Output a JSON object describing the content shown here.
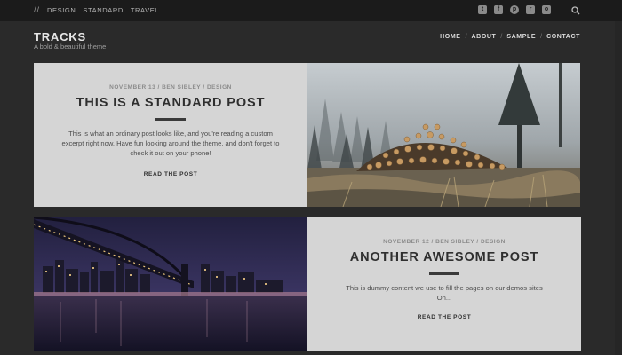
{
  "topbar": {
    "slashes": "//",
    "nav": [
      "DESIGN",
      "STANDARD",
      "TRAVEL"
    ],
    "socials": [
      {
        "icon": "twitter-icon",
        "glyph": "t"
      },
      {
        "icon": "facebook-icon",
        "glyph": "f"
      },
      {
        "icon": "pinterest-icon",
        "glyph": "p"
      },
      {
        "icon": "rss-icon",
        "glyph": "r"
      },
      {
        "icon": "instagram-icon",
        "glyph": "o"
      }
    ],
    "search_icon": "search-icon"
  },
  "header": {
    "brand": "TRACKS",
    "tagline": "A bold & beautiful theme",
    "nav": [
      "HOME",
      "ABOUT",
      "SAMPLE",
      "CONTACT"
    ],
    "separator": "/"
  },
  "posts": [
    {
      "meta": "NOVEMBER 13 / BEN SIBLEY / DESIGN",
      "title": "THIS IS A STANDARD POST",
      "excerpt": "This is what an ordinary post looks like, and you're reading a custom excerpt right now. Have fun looking around the theme, and don't forget to check it out on your phone!",
      "read_more": "READ THE POST",
      "image": "foggy-forest-log-pile"
    },
    {
      "meta": "NOVEMBER 12 / BEN SIBLEY / DESIGN",
      "title": "ANOTHER AWESOME POST",
      "excerpt": "This is dummy content we use to fill the pages on our demos sites On...",
      "read_more": "READ THE POST",
      "image": "city-bridge-at-night"
    }
  ],
  "colors": {
    "background": "#2a2a2a",
    "topbar": "#1b1b1b",
    "panel": "#d5d5d5",
    "title": "#2f2f2f"
  }
}
